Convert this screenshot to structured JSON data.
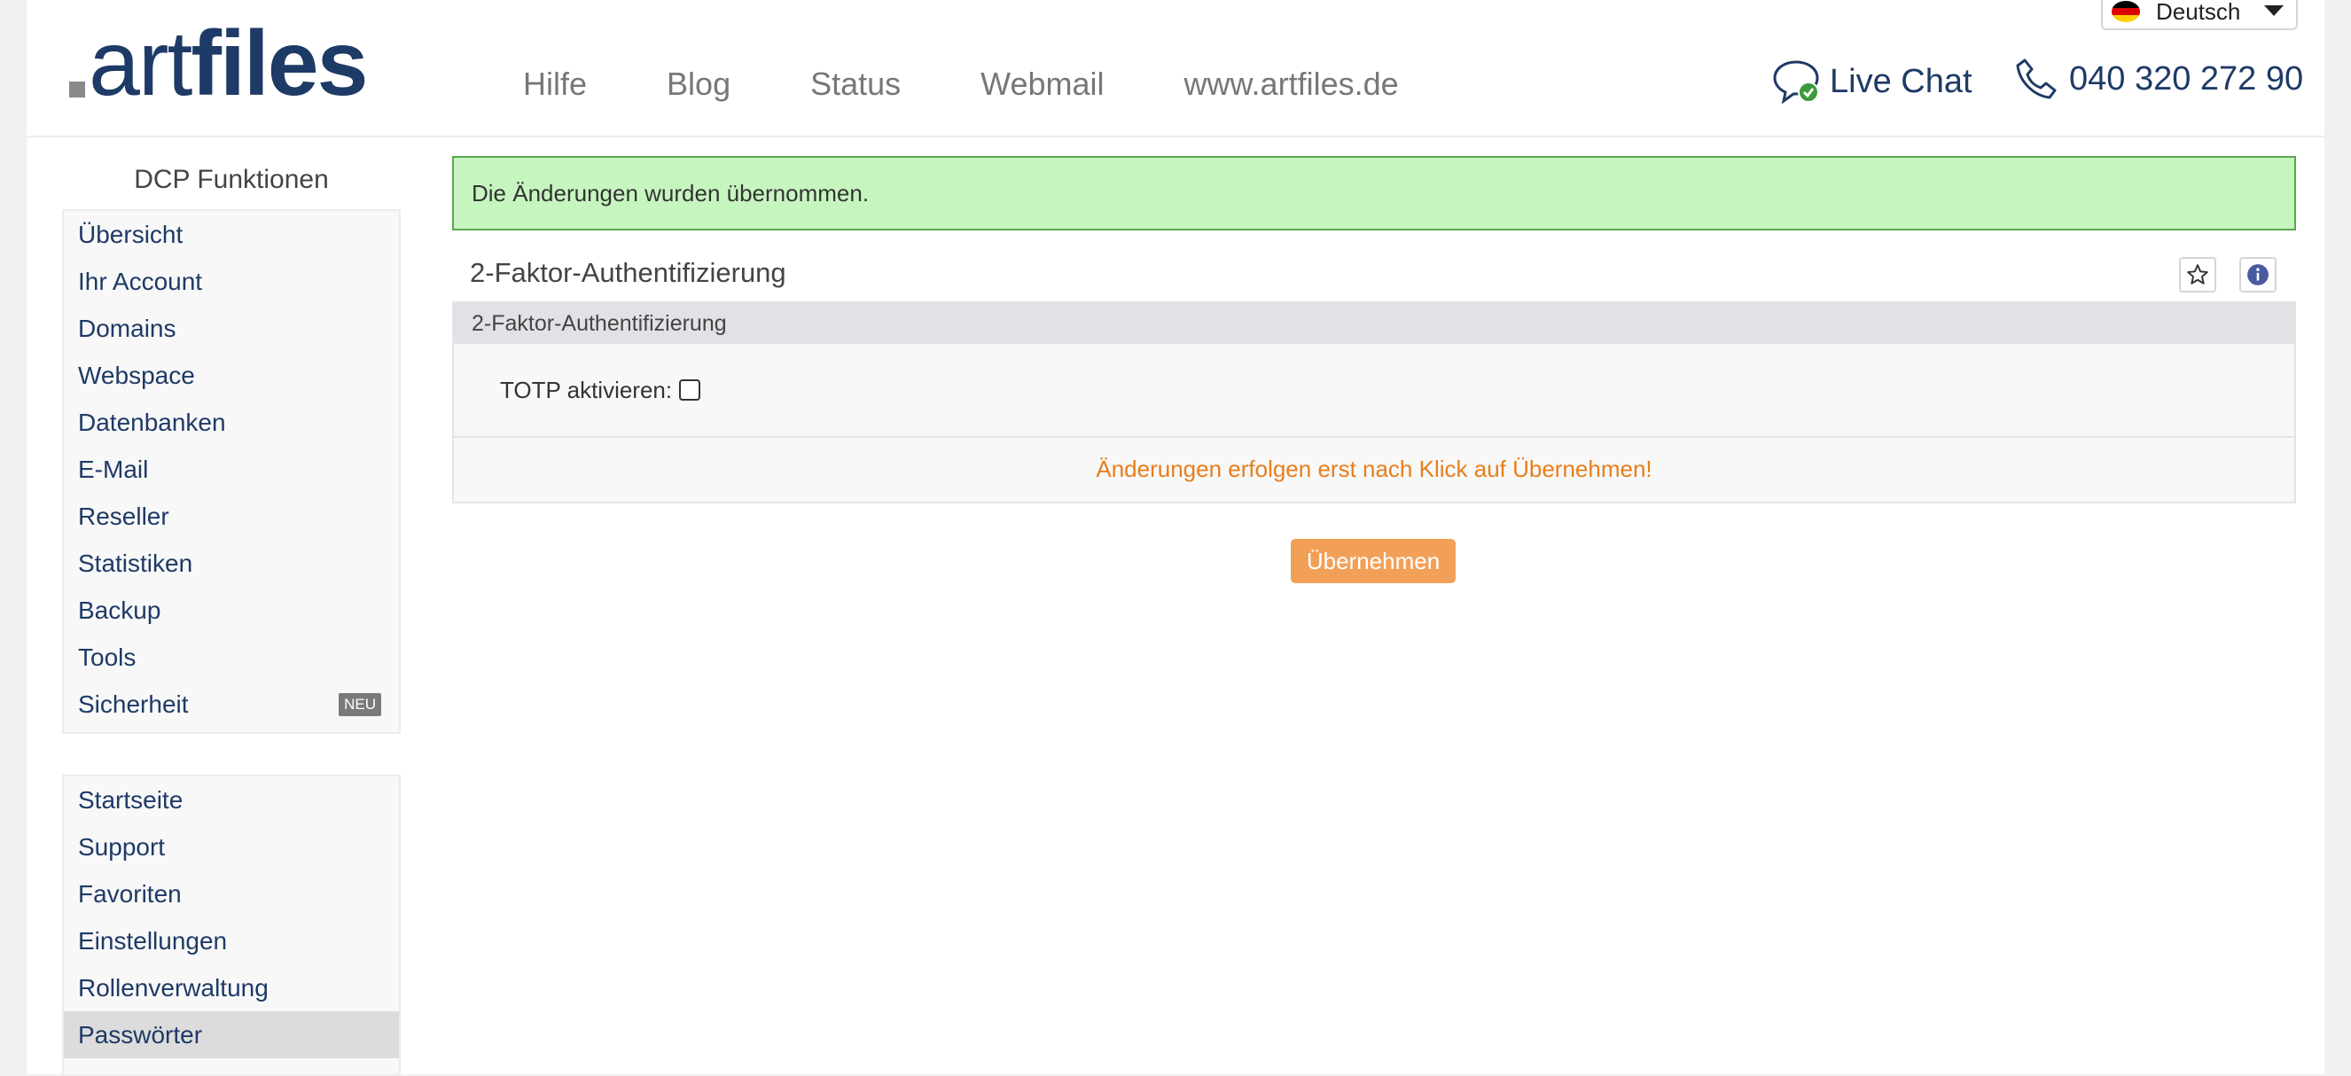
{
  "brand": {
    "logo_prefix": "art",
    "logo_suffix": "files"
  },
  "topnav": {
    "items": [
      {
        "label": "Hilfe"
      },
      {
        "label": "Blog"
      },
      {
        "label": "Status"
      },
      {
        "label": "Webmail"
      },
      {
        "label": "www.artfiles.de"
      }
    ]
  },
  "language": {
    "selected": "Deutsch",
    "flag_colors": [
      "#000000",
      "#dd0000",
      "#ffce00"
    ]
  },
  "contact": {
    "live_chat_label": "Live Chat",
    "phone": "040 320 272 90"
  },
  "sidebar": {
    "title": "DCP Funktionen",
    "group1": [
      {
        "label": "Übersicht"
      },
      {
        "label": "Ihr Account"
      },
      {
        "label": "Domains"
      },
      {
        "label": "Webspace"
      },
      {
        "label": "Datenbanken"
      },
      {
        "label": "E-Mail"
      },
      {
        "label": "Reseller"
      },
      {
        "label": "Statistiken"
      },
      {
        "label": "Backup"
      },
      {
        "label": "Tools"
      },
      {
        "label": "Sicherheit",
        "badge": "NEU"
      }
    ],
    "group2": [
      {
        "label": "Startseite"
      },
      {
        "label": "Support"
      },
      {
        "label": "Favoriten"
      },
      {
        "label": "Einstellungen"
      },
      {
        "label": "Rollenverwaltung"
      },
      {
        "label": "Passwörter",
        "active": true
      }
    ]
  },
  "main": {
    "alert": "Die Änderungen wurden übernommen.",
    "title": "2-Faktor-Authentifizierung",
    "panel": {
      "header": "2-Faktor-Authentifizierung",
      "totp_label": "TOTP aktivieren:",
      "totp_checked": false,
      "note": "Änderungen erfolgen erst nach Klick auf Übernehmen!"
    },
    "submit_label": "Übernehmen"
  },
  "colors": {
    "brand_blue": "#1e3a66",
    "alert_bg": "#c7f5c0",
    "note_orange": "#e87e1b",
    "button_orange": "#f2a057"
  }
}
